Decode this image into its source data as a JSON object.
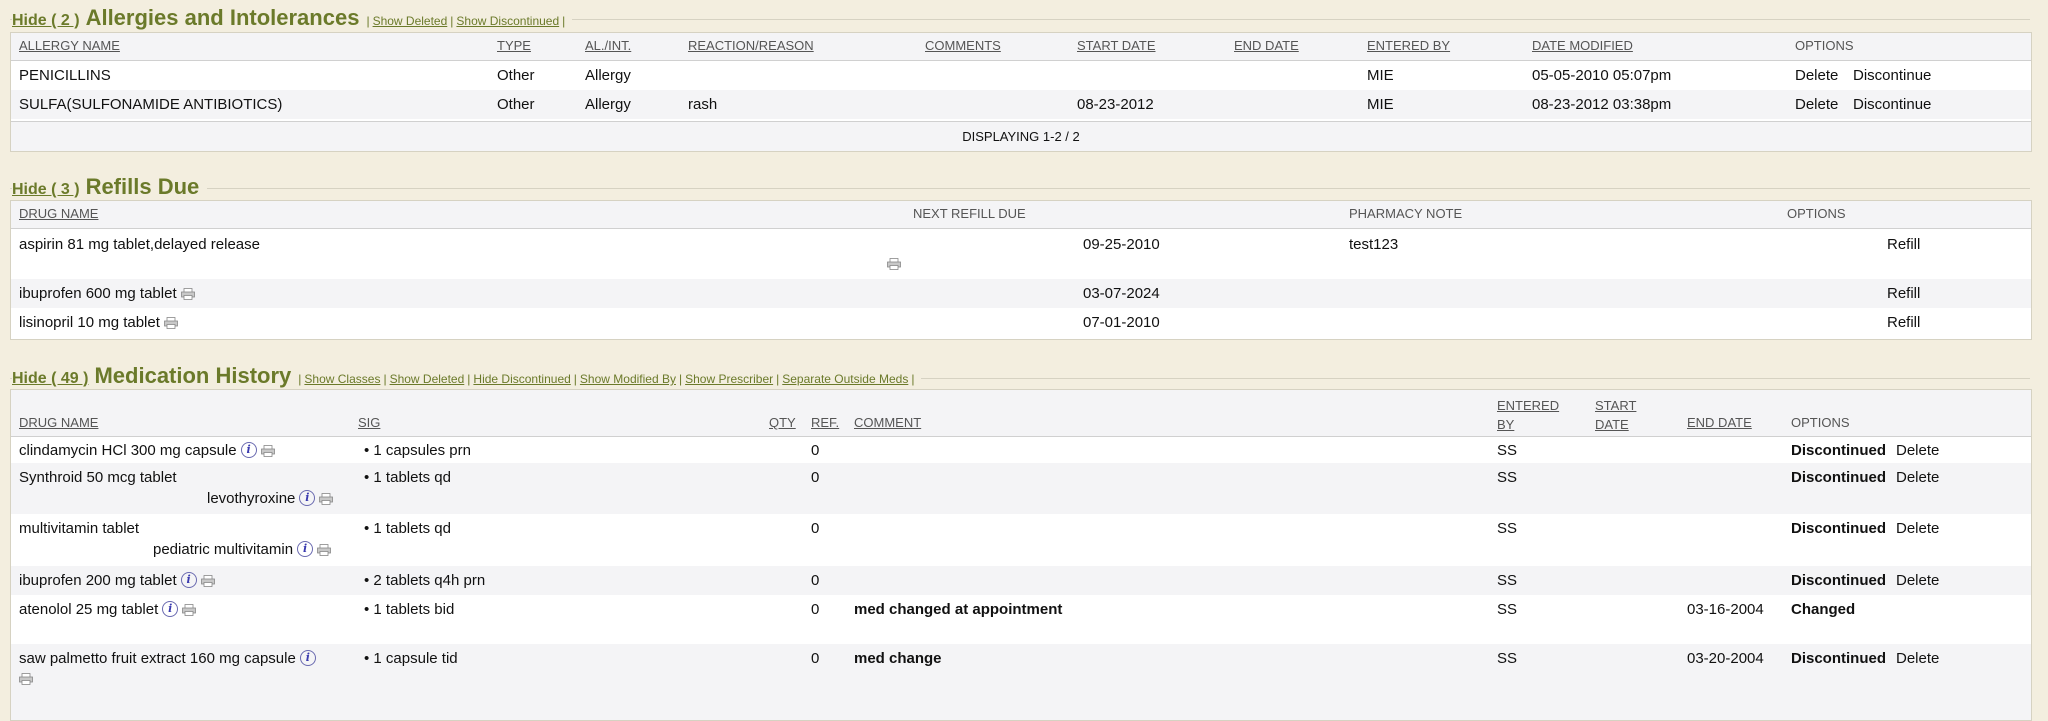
{
  "allergies": {
    "hide_label": "Hide ( 2 )",
    "title": "Allergies and Intolerances",
    "links": [
      "Show Deleted",
      "Show Discontinued"
    ],
    "columns": [
      "ALLERGY NAME",
      "TYPE",
      "AL./INT.",
      "REACTION/REASON",
      "COMMENTS",
      "START DATE",
      "END DATE",
      "ENTERED BY",
      "DATE MODIFIED",
      "OPTIONS"
    ],
    "rows": [
      {
        "name": "PENICILLINS",
        "type": "Other",
        "alint": "Allergy",
        "reaction": "",
        "comments": "",
        "start": "",
        "end": "",
        "entered": "MIE",
        "modified": "05-05-2010 05:07pm",
        "delete": "Delete",
        "discontinue": "Discontinue"
      },
      {
        "name": "SULFA(SULFONAMIDE ANTIBIOTICS)",
        "type": "Other",
        "alint": "Allergy",
        "reaction": "rash",
        "comments": "",
        "start": "08-23-2012",
        "end": "",
        "entered": "MIE",
        "modified": "08-23-2012 03:38pm",
        "delete": "Delete",
        "discontinue": "Discontinue"
      }
    ],
    "footer": "DISPLAYING 1-2 / 2"
  },
  "refills": {
    "hide_label": "Hide ( 3 )",
    "title": "Refills Due",
    "columns": [
      "DRUG NAME",
      "NEXT REFILL DUE",
      "PHARMACY NOTE",
      "OPTIONS"
    ],
    "rows": [
      {
        "drug": "aspirin 81 mg tablet,delayed release",
        "due": "09-25-2010",
        "note": "test123",
        "option": "Refill"
      },
      {
        "drug": "ibuprofen 600 mg tablet",
        "due": "03-07-2024",
        "note": "",
        "option": "Refill"
      },
      {
        "drug": "lisinopril 10 mg tablet",
        "due": "07-01-2010",
        "note": "",
        "option": "Refill"
      }
    ]
  },
  "meds": {
    "hide_label": "Hide ( 49 )",
    "title": "Medication History",
    "links": [
      "Show Classes",
      "Show Deleted",
      "Hide Discontinued",
      "Show Modified By",
      "Show Prescriber",
      "Separate Outside Meds"
    ],
    "columns": {
      "drug": "DRUG NAME",
      "sig": "SIG",
      "qty": "QTY",
      "ref": "REF.",
      "comment": "COMMENT",
      "entered_1": "ENTERED",
      "entered_2": "BY",
      "start_1": "START",
      "start_2": "DATE",
      "end": "END DATE",
      "options": "OPTIONS"
    },
    "rows": [
      {
        "drug": "clindamycin HCl 300 mg capsule",
        "generic": "",
        "sig": "1 capsules prn",
        "ref": "0",
        "comment": "",
        "entered": "SS",
        "end": "",
        "status": "Discontinued",
        "delete": "Delete"
      },
      {
        "drug": "Synthroid 50 mcg tablet",
        "generic": "levothyroxine",
        "sig": "1 tablets qd",
        "ref": "0",
        "comment": "",
        "entered": "SS",
        "end": "",
        "status": "Discontinued",
        "delete": "Delete"
      },
      {
        "drug": "multivitamin tablet",
        "generic": "pediatric multivitamin",
        "sig": "1 tablets qd",
        "ref": "0",
        "comment": "",
        "entered": "SS",
        "end": "",
        "status": "Discontinued",
        "delete": "Delete"
      },
      {
        "drug": "ibuprofen 200 mg tablet",
        "generic": "",
        "sig": "2 tablets q4h prn",
        "ref": "0",
        "comment": "",
        "entered": "SS",
        "end": "",
        "status": "Discontinued",
        "delete": "Delete"
      },
      {
        "drug": "atenolol 25 mg tablet",
        "generic": "",
        "sig": "1 tablets bid",
        "ref": "0",
        "comment": "med changed at appointment",
        "entered": "SS",
        "end": "03-16-2004",
        "status": "Changed",
        "delete": ""
      },
      {
        "drug": "saw palmetto fruit extract 160 mg capsule",
        "generic": "",
        "sig": "1 capsule tid",
        "ref": "0",
        "comment": "med change",
        "entered": "SS",
        "end": "03-20-2004",
        "status": "Discontinued",
        "delete": "Delete"
      }
    ]
  },
  "icons": {
    "info": "info-icon",
    "print": "printer-icon"
  }
}
